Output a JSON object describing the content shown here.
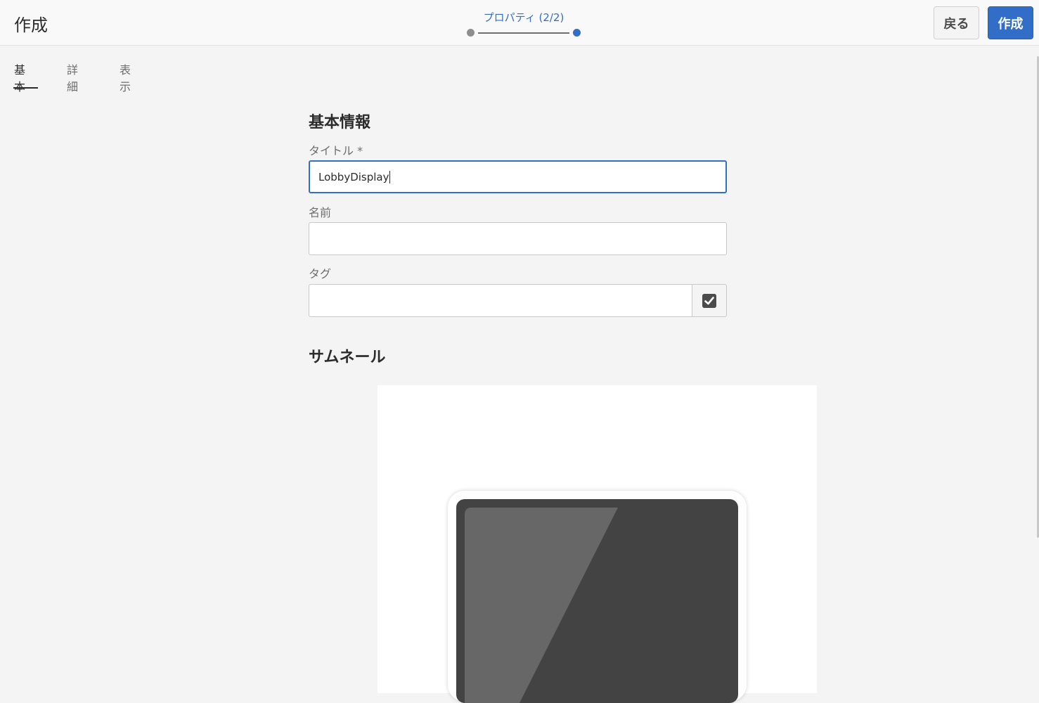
{
  "header": {
    "title": "作成",
    "wizard_step": "プロパティ (2/2)",
    "back_label": "戻る",
    "create_label": "作成"
  },
  "tabs": [
    {
      "label": "基本",
      "active": true
    },
    {
      "label": "詳細",
      "active": false
    },
    {
      "label": "表示",
      "active": false
    }
  ],
  "form": {
    "section_basic": "基本情報",
    "title_label": "タイトル *",
    "title_value": "LobbyDisplay",
    "name_label": "名前",
    "name_value": "",
    "tag_label": "タグ",
    "tag_value": "",
    "tag_button_icon": "checkbox-checked-icon",
    "section_thumbnail": "サムネール"
  },
  "colors": {
    "accent": "#326ec8",
    "background": "#f4f4f4",
    "screen": "#434343"
  }
}
